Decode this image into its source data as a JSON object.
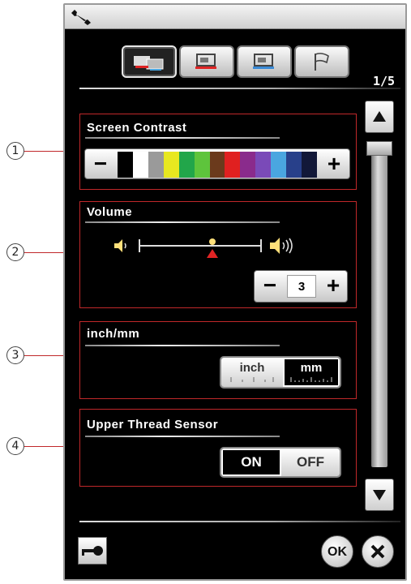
{
  "header": {
    "icon": "wrench-icon"
  },
  "tabs": [
    {
      "icon": "common-settings-icon",
      "active": true
    },
    {
      "icon": "sewing-settings-icon",
      "active": false
    },
    {
      "icon": "embroidery-settings-icon",
      "active": false
    },
    {
      "icon": "language-flag-icon",
      "active": false
    }
  ],
  "page_indicator": "1/5",
  "callouts": [
    "1",
    "2",
    "3",
    "4"
  ],
  "screen_contrast": {
    "title": "Screen Contrast",
    "minus": "−",
    "plus": "+",
    "swatches": [
      "#000000",
      "#ffffff",
      "#9a9a9a",
      "#e8e820",
      "#22a64a",
      "#5ec43c",
      "#6b3a1c",
      "#e02020",
      "#8a2b8c",
      "#7a4ab8",
      "#4aa6e0",
      "#28408a",
      "#121838"
    ]
  },
  "volume": {
    "title": "Volume",
    "minus": "−",
    "plus": "+",
    "value": "3",
    "level_fraction": 0.6,
    "speaker_low_icon": "speaker-low-icon",
    "speaker_high_icon": "speaker-high-icon"
  },
  "units": {
    "title": "inch/mm",
    "inch_label": "inch",
    "mm_label": "mm",
    "selected": "mm"
  },
  "thread_sensor": {
    "title": "Upper Thread Sensor",
    "on_label": "ON",
    "off_label": "OFF",
    "selected": "ON"
  },
  "footer": {
    "ok_label": "OK",
    "close_icon": "close-icon",
    "key_icon": "key-icon"
  }
}
